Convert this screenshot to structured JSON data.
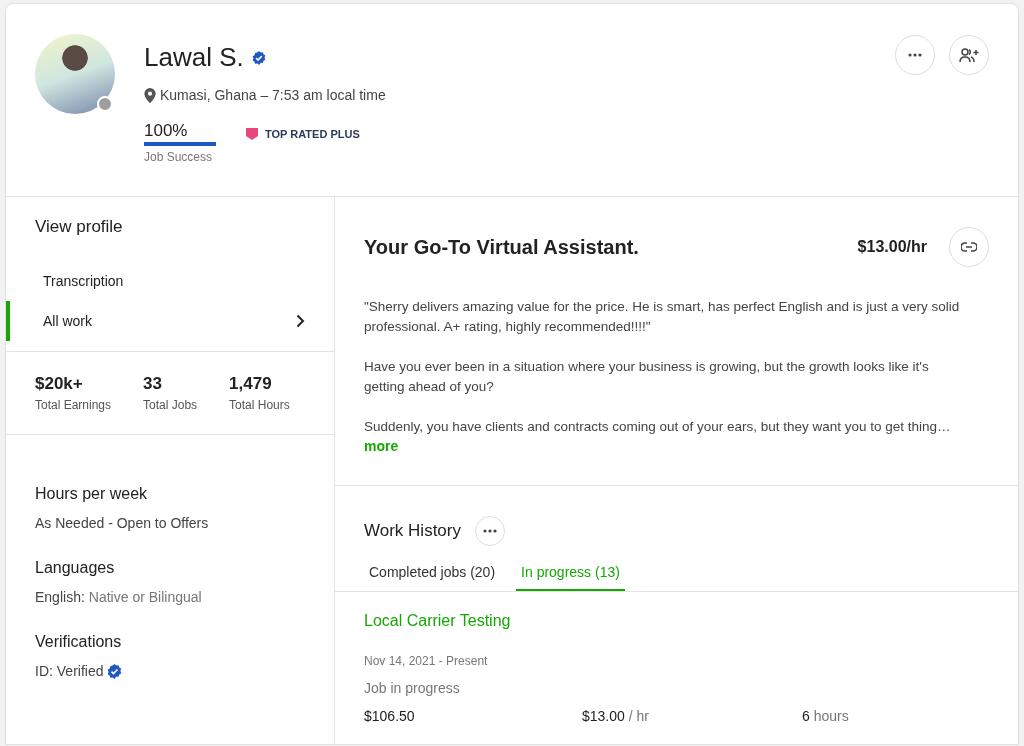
{
  "profile": {
    "name": "Lawal S.",
    "verified": true,
    "online": false,
    "location": "Kumasi, Ghana – 7:53 am local time",
    "job_success": {
      "value": "100%",
      "label": "Job Success",
      "level": 1
    },
    "badge": "TOP RATED PLUS"
  },
  "sidebar": {
    "title": "View profile",
    "items": [
      {
        "label": "Transcription",
        "selected": false
      },
      {
        "label": "All work",
        "selected": true
      }
    ],
    "stats": [
      {
        "value": "$20k+",
        "label": "Total Earnings"
      },
      {
        "value": "33",
        "label": "Total Jobs"
      },
      {
        "value": "1,479",
        "label": "Total Hours"
      }
    ],
    "sections": [
      {
        "title": "Hours per week",
        "kind": "text",
        "text": "As Needed - Open to Offers"
      },
      {
        "title": "Languages",
        "kind": "pair",
        "key": "English:",
        "text": "Native or Bilingual"
      },
      {
        "title": "Verifications",
        "kind": "verified",
        "key": "ID:",
        "text": "Verified"
      }
    ]
  },
  "overview": {
    "title": "Your Go-To Virtual Assistant.",
    "rate": "$13.00/hr",
    "paragraphs": [
      "\"Sherry delivers amazing value for the price. He is smart, has perfect English and is just a very solid professional. A+ rating, highly recommended!!!!\"",
      "Have you ever been in a situation where your business is growing, but the growth looks like it's getting ahead of you?",
      "Suddenly, you have clients and contracts coming out of your ears, but they want you to get thing…"
    ],
    "more": "more"
  },
  "work_history": {
    "title": "Work History",
    "tabs": [
      {
        "label": "Completed jobs (20)",
        "selected": false
      },
      {
        "label": "In progress (13)",
        "selected": true
      }
    ],
    "jobs": [
      {
        "title": "Local Carrier Testing",
        "dates": "Nov 14, 2021 - Present",
        "status": "Job in progress",
        "earned": "$106.50",
        "rate": "$13.00",
        "rate_unit": "/ hr",
        "hours": "6",
        "hours_unit": "hours"
      }
    ]
  }
}
